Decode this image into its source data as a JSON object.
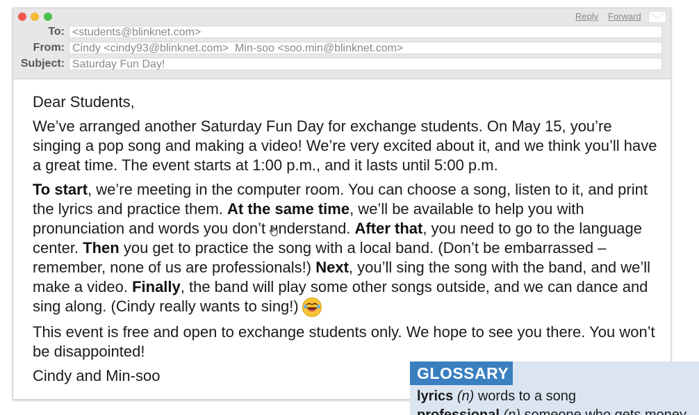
{
  "window": {
    "reply_label": "Reply",
    "forward_label": "Forward",
    "icons": {
      "close": "close-dot",
      "minimize": "minimize-dot",
      "zoom": "zoom-dot",
      "compose": "envelope-icon",
      "cursor": "hand-cursor-icon",
      "emoji": "laughing-face-emoji"
    }
  },
  "headers": {
    "to_label": "To:",
    "to_value": "<students@blinknet.com>",
    "from_label": "From:",
    "from_value": "Cindy <cindy93@blinknet.com>  Min-soo <soo.min@blinknet.com>",
    "subject_label": "Subject:",
    "subject_value": "Saturday Fun Day!"
  },
  "message": {
    "greeting": "Dear Students,",
    "para1": "We’ve arranged another Saturday Fun Day for exchange students. On May 15, you’re singing a pop song and making a video! We’re very excited about it, and we think you’ll have a great time. The event starts at 1:00 p.m., and it lasts until 5:00 p.m.",
    "p2_b1": "To start",
    "p2_t1": ", we’re meeting in the computer room. You can choose a song, listen to it, and print the lyrics and practice them. ",
    "p2_b2": "At the same time",
    "p2_t2": ", we’ll be available to help you with pronunciation and words you don’t understand. ",
    "p2_b3": "After that",
    "p2_t3": ", you need to go to the language center. ",
    "p2_b4": "Then",
    "p2_t4": " you get to practice the song with a local band. (Don’t be embarrassed – remember, none of us are professionals!) ",
    "p2_b5": "Next",
    "p2_t5": ", you’ll sing the song with the band, and we’ll make a video. ",
    "p2_b6": "Finally",
    "p2_t6": ", the band will play some other songs outside, and we can dance and sing along. (Cindy really wants to sing!)",
    "para3": "This event is free and open to exchange students only. We hope to see you there. You won’t be disappointed!",
    "signature": "Cindy and Min-soo"
  },
  "glossary": {
    "title": "GLOSSARY",
    "entries": [
      {
        "term": "lyrics",
        "pos": "(n)",
        "definition": "words to a song"
      },
      {
        "term": "professional",
        "pos": "(n)",
        "definition": "someone who gets money"
      }
    ]
  },
  "colors": {
    "glossary_title_bg": "#3a7fc0",
    "glossary_bg": "#dbe5f2",
    "header_bg": "#e7e7e7"
  }
}
